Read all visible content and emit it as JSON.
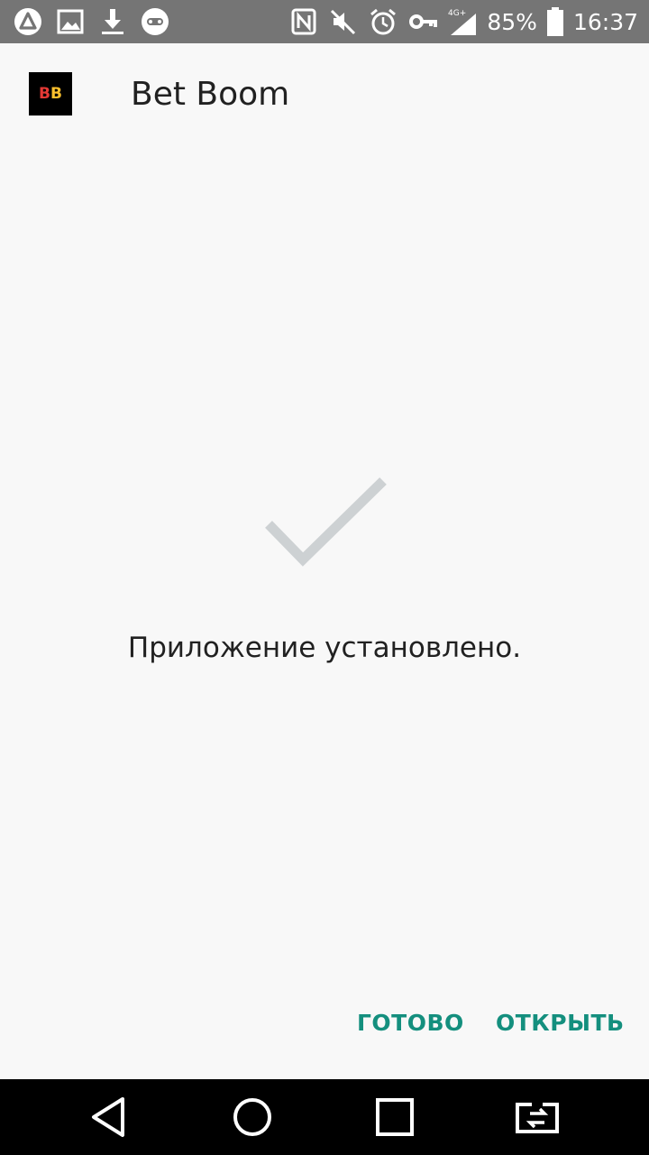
{
  "status_bar": {
    "left_icons": [
      "app-notification-icon",
      "gallery-icon",
      "download-icon",
      "game-controller-icon"
    ],
    "right_icons": [
      "nfc-icon",
      "mute-icon",
      "alarm-icon",
      "vpn-key-icon",
      "signal-4g-icon",
      "battery-icon"
    ],
    "network_label": "4G+",
    "battery_percent": "85%",
    "time": "16:37"
  },
  "app": {
    "icon_letter_1": "B",
    "icon_letter_2": "B",
    "title": "Bet Boom"
  },
  "main": {
    "message": "Приложение установлено.",
    "checkmark_color": "#cdd1d3"
  },
  "actions": {
    "done_label": "ГОТОВО",
    "open_label": "ОТКРЫТЬ",
    "accent_color": "#148f7e"
  },
  "nav_bar": {
    "icons": [
      "back-icon",
      "home-icon",
      "recents-icon",
      "app-switch-icon"
    ]
  }
}
